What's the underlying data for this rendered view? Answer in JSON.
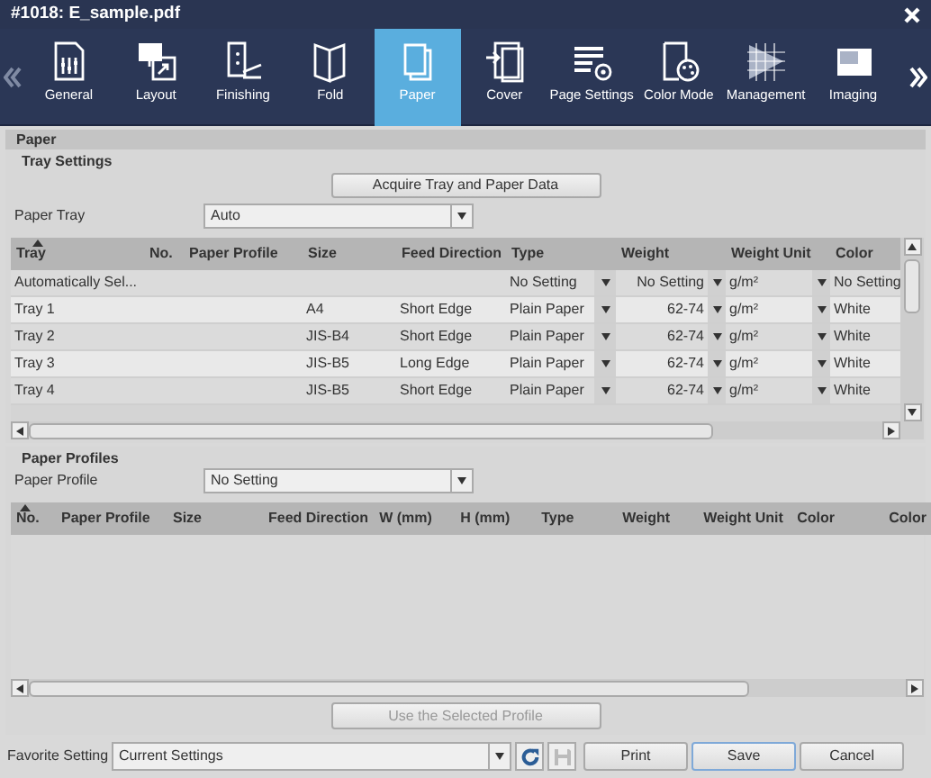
{
  "window": {
    "title": "#1018: E_sample.pdf"
  },
  "toolbar": {
    "tabs": [
      {
        "label": "General",
        "selected": false
      },
      {
        "label": "Layout",
        "selected": false
      },
      {
        "label": "Finishing",
        "selected": false
      },
      {
        "label": "Fold",
        "selected": false
      },
      {
        "label": "Paper",
        "selected": true
      },
      {
        "label": "Cover",
        "selected": false
      },
      {
        "label": "Page Settings",
        "selected": false
      },
      {
        "label": "Color Mode",
        "selected": false
      },
      {
        "label": "Management",
        "selected": false
      },
      {
        "label": "Imaging",
        "selected": false
      }
    ]
  },
  "section_title": "Paper",
  "tray_settings": {
    "title": "Tray Settings",
    "acquire_button": "Acquire Tray and Paper Data",
    "paper_tray": {
      "label": "Paper Tray",
      "value": "Auto"
    },
    "table": {
      "columns": [
        {
          "label": "Tray",
          "sorted": true,
          "dropdown": false
        },
        {
          "label": "No.",
          "sorted": false,
          "dropdown": false
        },
        {
          "label": "Paper Profile",
          "sorted": false,
          "dropdown": false
        },
        {
          "label": "Size",
          "sorted": false,
          "dropdown": false
        },
        {
          "label": "Feed Direction",
          "sorted": false,
          "dropdown": false
        },
        {
          "label": "Type",
          "sorted": false,
          "dropdown": true
        },
        {
          "label": "Weight",
          "sorted": false,
          "dropdown": true
        },
        {
          "label": "Weight Unit",
          "sorted": false,
          "dropdown": true
        },
        {
          "label": "Color",
          "sorted": false,
          "dropdown": false
        }
      ],
      "rows": [
        [
          "Automatically Sel...",
          "",
          "",
          "",
          "",
          "No Setting",
          "No Setting",
          "g/m²",
          "No Setting"
        ],
        [
          "Tray 1",
          "",
          "",
          "A4",
          "Short Edge",
          "Plain Paper",
          "62-74",
          "g/m²",
          "White"
        ],
        [
          "Tray 2",
          "",
          "",
          "JIS-B4",
          "Short Edge",
          "Plain Paper",
          "62-74",
          "g/m²",
          "White"
        ],
        [
          "Tray 3",
          "",
          "",
          "JIS-B5",
          "Long Edge",
          "Plain Paper",
          "62-74",
          "g/m²",
          "White"
        ],
        [
          "Tray 4",
          "",
          "",
          "JIS-B5",
          "Short Edge",
          "Plain Paper",
          "62-74",
          "g/m²",
          "White"
        ]
      ]
    }
  },
  "paper_profiles": {
    "title": "Paper Profiles",
    "paper_profile": {
      "label": "Paper Profile",
      "value": "No Setting"
    },
    "table": {
      "columns": [
        {
          "label": "No.",
          "sorted": true
        },
        {
          "label": "Paper Profile",
          "sorted": false
        },
        {
          "label": "Size",
          "sorted": false
        },
        {
          "label": "Feed Direction",
          "sorted": false
        },
        {
          "label": "W (mm)",
          "sorted": false
        },
        {
          "label": "H (mm)",
          "sorted": false
        },
        {
          "label": "Type",
          "sorted": false
        },
        {
          "label": "Weight",
          "sorted": false
        },
        {
          "label": "Weight Unit",
          "sorted": false
        },
        {
          "label": "Color",
          "sorted": false
        },
        {
          "label": "Color",
          "sorted": false
        }
      ]
    },
    "use_button": {
      "label": "Use the Selected Profile",
      "disabled": true
    }
  },
  "footer": {
    "favorite_label": "Favorite Setting",
    "favorite_value": "Current Settings",
    "save_icon_disabled": true,
    "buttons": [
      {
        "label": "Print",
        "focused": false
      },
      {
        "label": "Save",
        "focused": true
      },
      {
        "label": "Cancel",
        "focused": false
      }
    ]
  }
}
